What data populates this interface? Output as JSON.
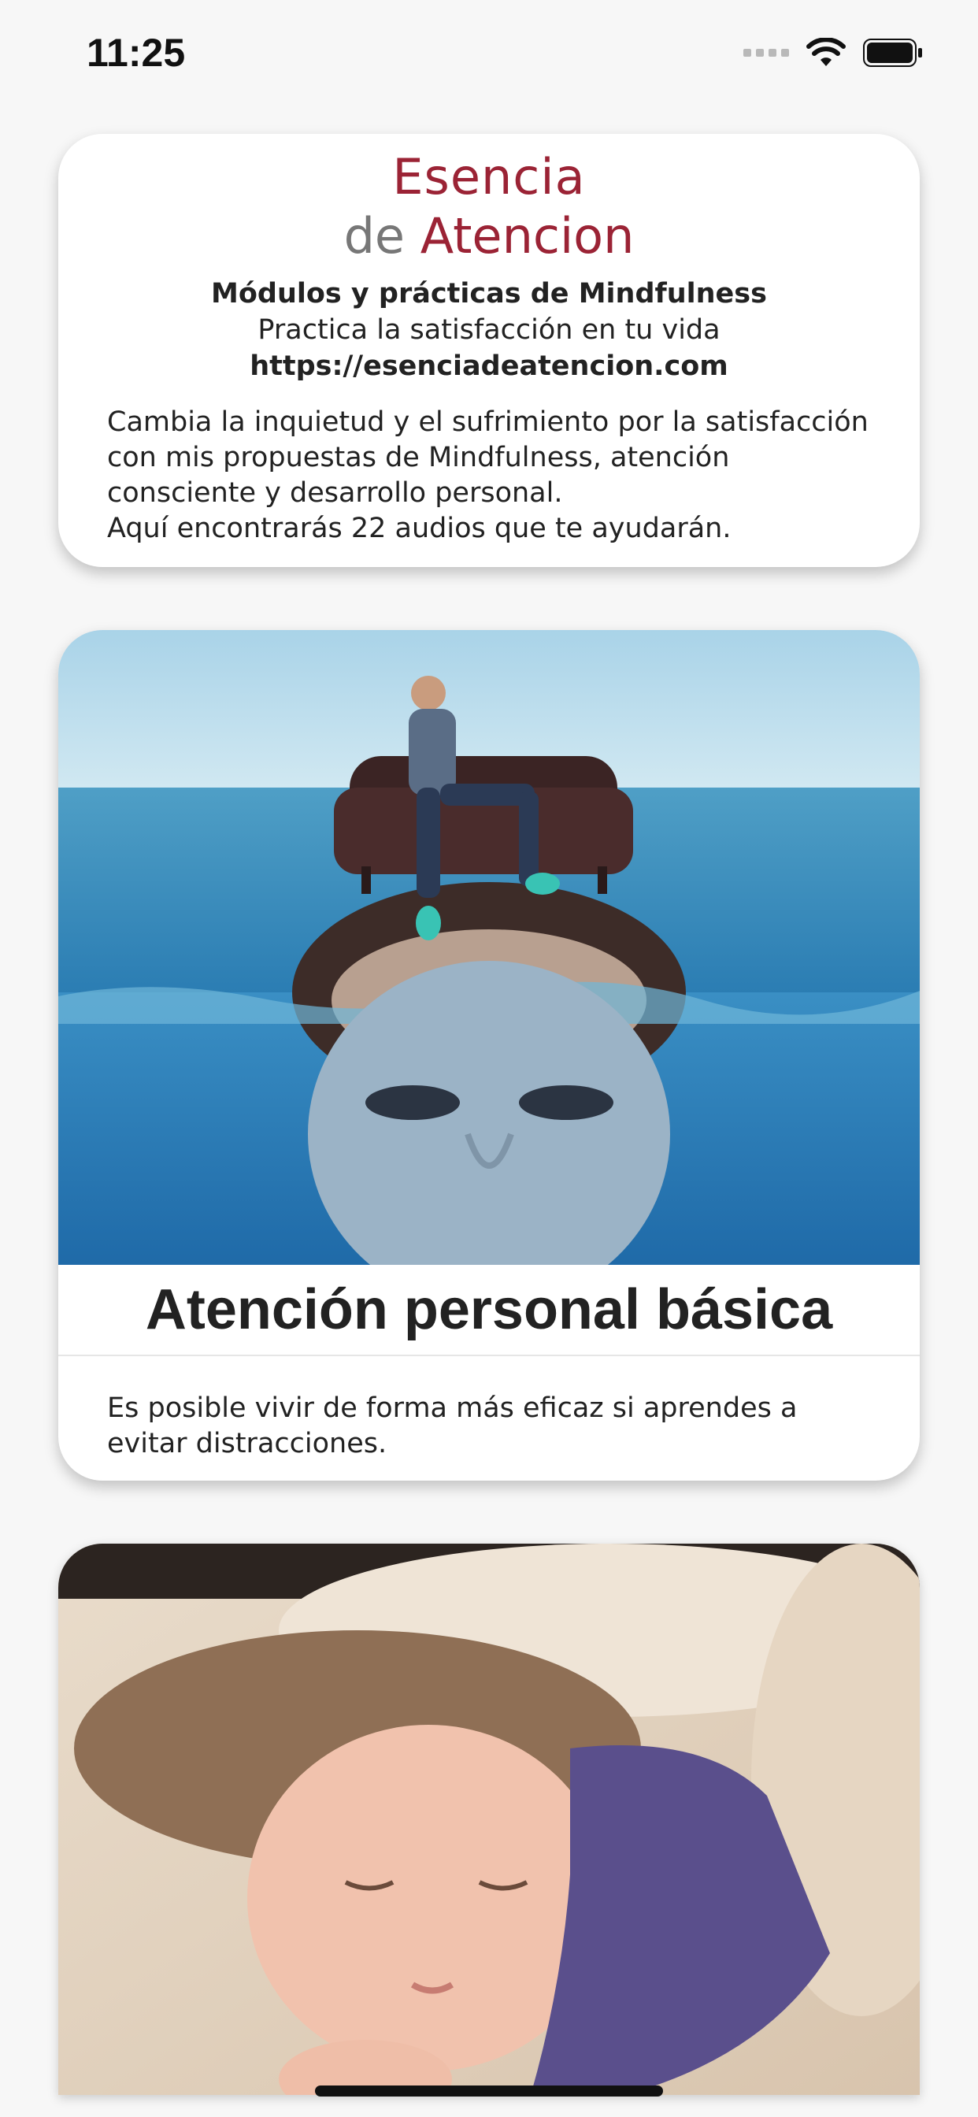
{
  "status_bar": {
    "time": "11:25",
    "icons": [
      "cellular-signal-icon",
      "wifi-icon",
      "battery-icon"
    ]
  },
  "header_card": {
    "logo": {
      "line1": "Esencia",
      "line2_prefix": "de",
      "line2_word": "Atencion"
    },
    "title": "Módulos y prácticas de Mindfulness",
    "subtitle": "Practica la satisfacción en tu vida",
    "url": "https://esenciadeatencion.com",
    "description_lines": [
      "Cambia la inquietud y el sufrimiento por la satisfacción",
      "con mis propuestas de Mindfulness, atención",
      "consciente y desarrollo personal.",
      "Aquí encontrarás 22 audios que te ayudarán."
    ]
  },
  "modules": [
    {
      "title": "Atención personal básica",
      "description_lines": [
        "Es posible vivir de forma más eficaz si aprendes a",
        "evitar distracciones."
      ]
    }
  ],
  "colors": {
    "brand": "#9b2335",
    "background": "#f7f7f7",
    "card": "#ffffff"
  }
}
